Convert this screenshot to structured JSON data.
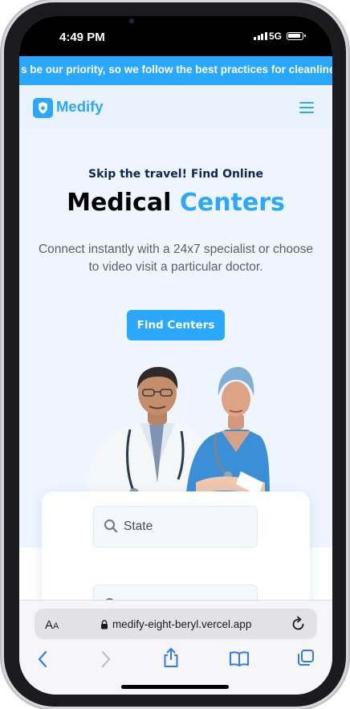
{
  "status_bar": {
    "time": "4:49 PM",
    "network": "5G"
  },
  "announcement": {
    "text": "s be our priority, so we follow the best practices for cleanlines"
  },
  "header": {
    "brand": "Medify",
    "menu_icon": "hamburger-icon"
  },
  "hero": {
    "kicker": "Skip the travel! Find Online",
    "title_main": "Medical",
    "title_accent": "Centers",
    "description": "Connect instantly with a 24x7 specialist or choose to video visit a particular doctor.",
    "cta_label": "Find Centers",
    "image_icon": "doctors-illustration"
  },
  "search": {
    "state_placeholder": "State",
    "city_placeholder": "",
    "icon": "search-icon"
  },
  "browser": {
    "aa_label": "AA",
    "url": "medify-eight-beryl.vercel.app",
    "icons": [
      "back-icon",
      "forward-icon",
      "share-icon",
      "bookmarks-icon",
      "tabs-icon",
      "reload-icon",
      "lock-icon"
    ]
  },
  "colors": {
    "accent": "#2aa7ff",
    "hero_bg": "#eef5ff",
    "nav_bg": "#eaf3fd",
    "dark_text": "#102851"
  }
}
